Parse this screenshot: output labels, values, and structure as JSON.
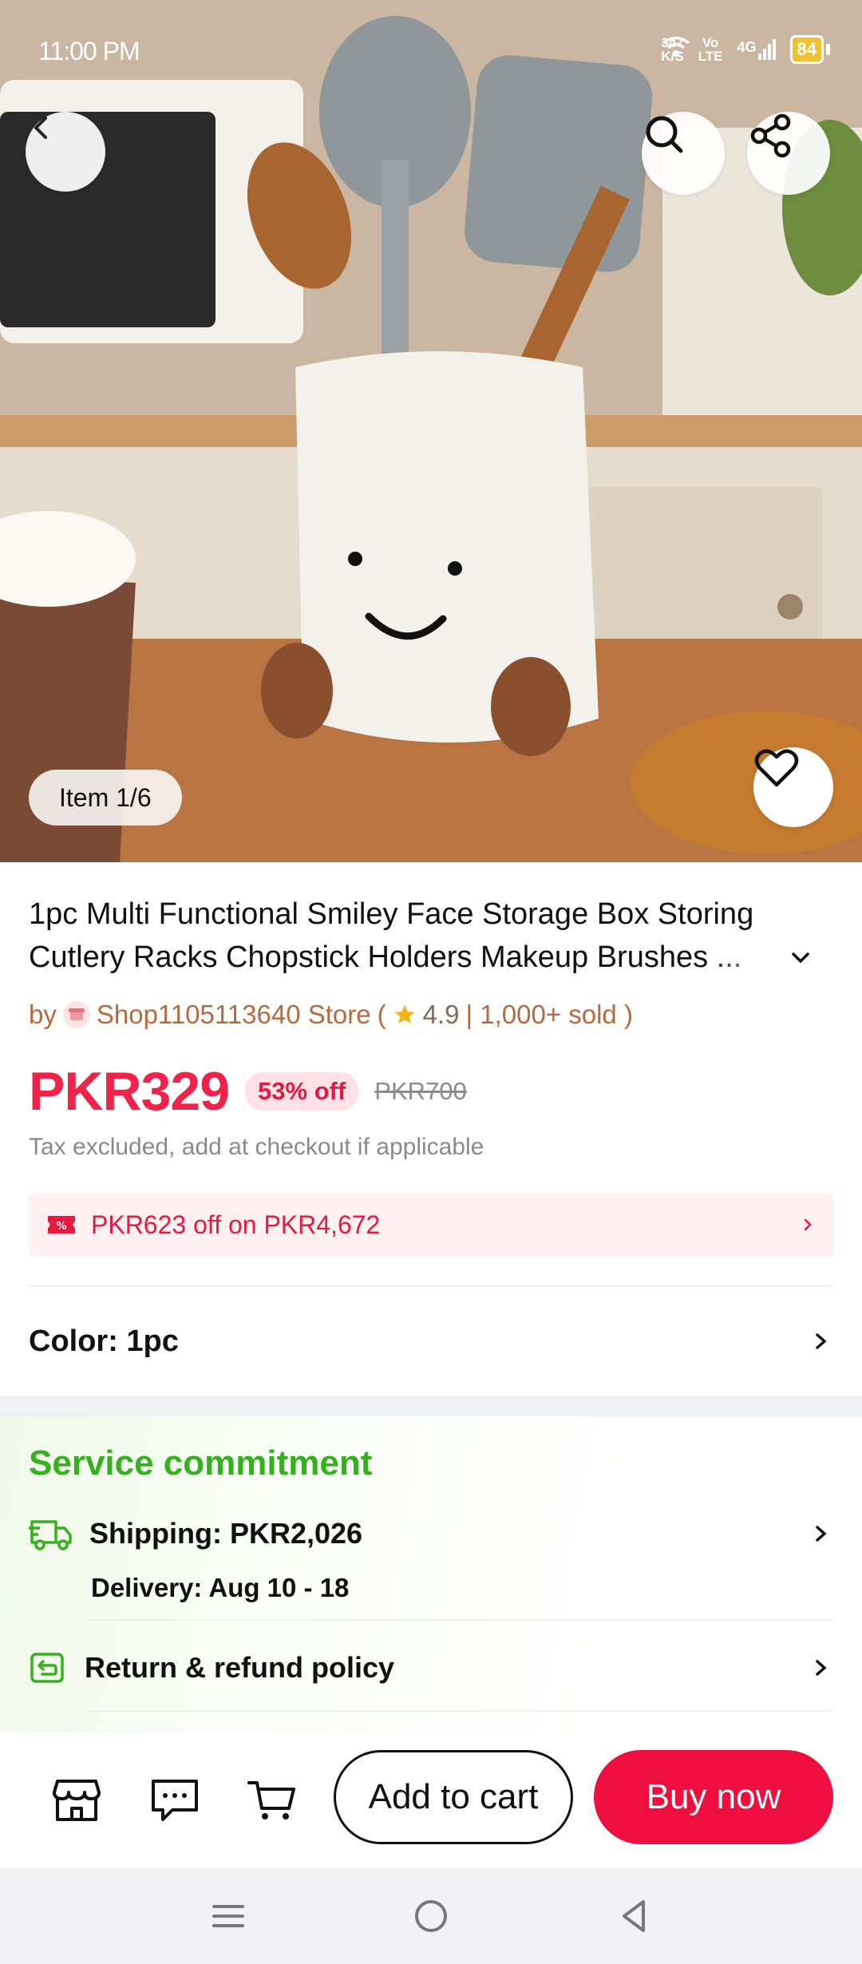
{
  "status_bar": {
    "time": "11:00 PM",
    "net_speed_value": "347",
    "net_speed_unit": "K/S",
    "volte_top": "Vo",
    "volte_bottom": "LTE",
    "network": "4G",
    "battery": "84"
  },
  "gallery": {
    "counter": "Item 1/6"
  },
  "product": {
    "title_line1": "1pc Multi Functional Smiley Face Storage Box Storing",
    "title_line2": "Cutlery Racks Chopstick Holders Makeup Brushes ...",
    "by_prefix": "by",
    "store_name": "Shop1105113640 Store",
    "rating_open": "(",
    "rating": "4.9",
    "sold": "| 1,000+ sold )",
    "price": "PKR329",
    "discount": "53% off",
    "original_price": "PKR700",
    "tax_note": "Tax excluded, add at checkout if applicable",
    "promo": "PKR623 off on PKR4,672",
    "color_label": "Color: 1pc"
  },
  "service": {
    "title": "Service commitment",
    "shipping": "Shipping: PKR2,026",
    "delivery": "Delivery: Aug 10 - 18",
    "refund": "Return & refund policy"
  },
  "actions": {
    "add_to_cart": "Add to cart",
    "buy_now": "Buy now"
  },
  "colors": {
    "accent_red": "#ee0f3f",
    "price_red": "#f0224a",
    "service_green": "#34b21e",
    "store_brown": "#b66a3f"
  },
  "icons": [
    "back-icon",
    "search-icon",
    "share-icon",
    "heart-icon",
    "star-icon",
    "coupon-icon",
    "chevron-right-icon",
    "truck-icon",
    "refund-icon",
    "store-icon",
    "chat-icon",
    "cart-icon",
    "menu-nav-icon",
    "home-nav-icon",
    "back-nav-icon"
  ]
}
